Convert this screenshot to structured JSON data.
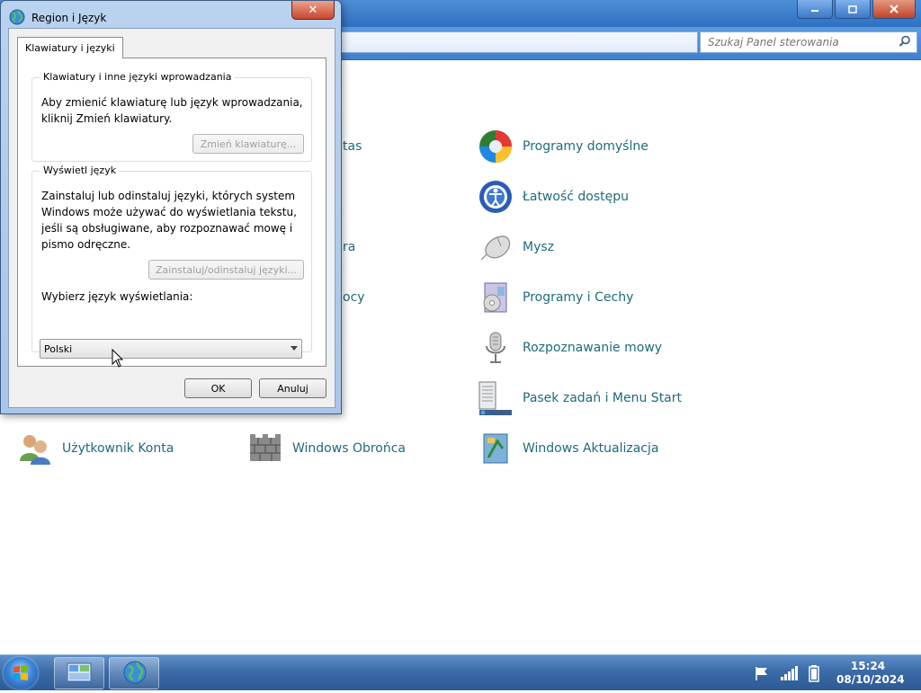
{
  "control_panel": {
    "search_placeholder": "Szukaj Panel sterowania",
    "partials": [
      "tas",
      "ra",
      "ocy"
    ],
    "items": [
      {
        "label": "Programy domyślne",
        "icon": "default-programs-icon"
      },
      {
        "label": "Łatwość dostępu",
        "icon": "ease-of-access-icon"
      },
      {
        "label": "Mysz",
        "icon": "mouse-icon"
      },
      {
        "label": "Programy i Cechy",
        "icon": "programs-features-icon"
      },
      {
        "label": "Rozpoznawanie mowy",
        "icon": "microphone-icon"
      },
      {
        "label": "Pasek zadań i Menu Start",
        "icon": "taskbar-icon"
      },
      {
        "label": "Użytkownik Konta",
        "icon": "user-accounts-icon"
      },
      {
        "label": "Windows Obrońca",
        "icon": "firewall-icon"
      },
      {
        "label": "Windows Aktualizacja",
        "icon": "windows-update-icon"
      }
    ]
  },
  "dialog": {
    "title": "Region i Język",
    "close_label": "✕",
    "tab_label": "Klawiatury i języki",
    "group_keyboards": {
      "title": "Klawiatury i inne języki wprowadzania",
      "text": [
        "Aby zmienić klawiaturę lub język wprowadzania,",
        "kliknij Zmień klawiatury."
      ],
      "button": "Zmień klawiaturę..."
    },
    "group_display": {
      "title": "Wyświetl język",
      "text": [
        "Zainstaluj lub odinstaluj języki, których system",
        "Windows może używać do wyświetlania tekstu,",
        "jeśli są obsługiwane, aby rozpoznawać mowę i",
        "pismo odręczne."
      ],
      "button": "Zainstaluj/odinstaluj języki...",
      "select_label": "Wybierz język wyświetlania:",
      "select_value": "Polski"
    },
    "ok_label": "OK",
    "cancel_label": "Anuluj"
  },
  "taskbar": {
    "time": "15:24",
    "date": "08/10/2024"
  },
  "colors": {
    "link": "#1e6b7a",
    "title_blue": "#3f80cf",
    "dialog_frame": "#b9d2ef",
    "close_red": "#c8452c"
  }
}
